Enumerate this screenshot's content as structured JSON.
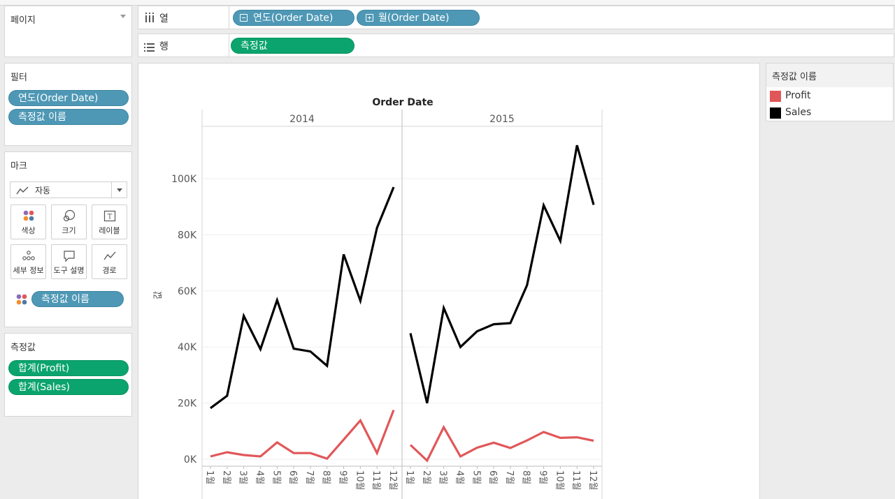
{
  "pages_card": {
    "title": "페이지"
  },
  "columns_shelf": {
    "label": "열",
    "pills": [
      "연도(Order Date)",
      "월(Order Date)"
    ]
  },
  "rows_shelf": {
    "label": "행",
    "pills": [
      "측정값"
    ]
  },
  "filters_card": {
    "title": "필터",
    "pills": [
      "연도(Order Date)",
      "측정값 이름"
    ]
  },
  "marks_card": {
    "title": "마크",
    "mark_type": "자동",
    "buttons": {
      "color": "색상",
      "size": "크기",
      "label": "레이블",
      "detail": "세부 정보",
      "tooltip": "도구 설명",
      "path": "경로"
    },
    "color_pill": "측정값 이름"
  },
  "measure_values_card": {
    "title": "측정값",
    "pills": [
      "합계(Profit)",
      "합계(Sales)"
    ]
  },
  "legend": {
    "title": "측정값 이름",
    "items": [
      {
        "label": "Profit",
        "color": "#e15759"
      },
      {
        "label": "Sales",
        "color": "#000000"
      }
    ]
  },
  "chart_data": {
    "type": "line",
    "title": "Order Date",
    "ylabel": "값",
    "ylim": [
      0,
      120000
    ],
    "yticks": [
      "0K",
      "20K",
      "40K",
      "60K",
      "80K",
      "100K"
    ],
    "ytick_values": [
      0,
      20000,
      40000,
      60000,
      80000,
      100000
    ],
    "months": [
      "1월",
      "2월",
      "3월",
      "4월",
      "5월",
      "6월",
      "7월",
      "8월",
      "9월",
      "10월",
      "11월",
      "12월"
    ],
    "panels": [
      {
        "year": "2014",
        "series": [
          {
            "name": "Sales",
            "color": "#000000",
            "values": [
              18200,
              22600,
              51100,
              39200,
              56700,
              39400,
              38400,
              33300,
              73000,
              56500,
              82500,
              97000
            ]
          },
          {
            "name": "Profit",
            "color": "#e15759",
            "values": [
              1000,
              2500,
              1500,
              1000,
              6000,
              2200,
              2200,
              200,
              7000,
              13800,
              2200,
              17500
            ]
          }
        ]
      },
      {
        "year": "2015",
        "series": [
          {
            "name": "Sales",
            "color": "#000000",
            "values": [
              44900,
              20000,
              53900,
              40000,
              45600,
              48100,
              48500,
              62000,
              90500,
              77800,
              111900,
              90700
            ]
          },
          {
            "name": "Profit",
            "color": "#e15759",
            "values": [
              5100,
              -500,
              11400,
              1000,
              4100,
              5900,
              4000,
              6700,
              9700,
              7600,
              7800,
              6600
            ]
          }
        ]
      }
    ]
  }
}
